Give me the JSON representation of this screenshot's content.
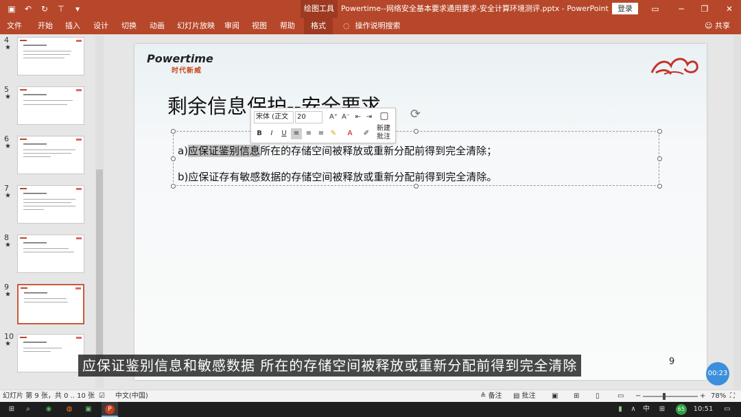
{
  "titlebar": {
    "context_tools": "绘图工具",
    "document_title": "Powertime--网络安全基本要求通用要求-安全计算环境测评.pptx - PowerPoint",
    "login": "登录",
    "restore_ribbon_icon": "ribbon-display-icon",
    "minimize": "─",
    "maximize": "❐",
    "close": "✕"
  },
  "ribbon": {
    "tabs": [
      "文件",
      "开始",
      "插入",
      "设计",
      "切换",
      "动画",
      "幻灯片放映",
      "审阅",
      "视图",
      "帮助",
      "格式"
    ],
    "active_tab": "格式",
    "tell_me": "操作说明搜索",
    "share": "共享"
  },
  "thumbnails": [
    {
      "num": "4",
      "star": "★"
    },
    {
      "num": "5",
      "star": "★"
    },
    {
      "num": "6",
      "star": "★"
    },
    {
      "num": "7",
      "star": "★"
    },
    {
      "num": "8",
      "star": "★"
    },
    {
      "num": "9",
      "star": "★"
    },
    {
      "num": "10",
      "star": "★"
    }
  ],
  "slide": {
    "logo_text": "Powertime",
    "logo_sub": "时代新威",
    "title": "剩余信息保护--安全要求",
    "bullet_a_prefix": "a)",
    "bullet_a_highlight": "应保证鉴别信息",
    "bullet_a_rest": "所在的存储空间被释放或重新分配前得到完全清除；",
    "bullet_b": "b)应保证存有敏感数据的存储空间被释放或重新分配前得到完全清除。",
    "number": "9"
  },
  "minibar": {
    "font": "宋体 (正文",
    "size": "20",
    "bold": "B",
    "italic": "I",
    "underline": "U",
    "new_comment": "新建批注"
  },
  "subtitle": "应保证鉴别信息和敏感数据  所在的存储空间被释放或重新分配前得到完全清除",
  "timer": "00:23",
  "statusbar": {
    "slide_info": "幻灯片 第 9 张，共 0 .. 10 张",
    "language": "中文(中国)",
    "notes": "备注",
    "comments": "批注",
    "zoom": "78%"
  },
  "taskbar": {
    "badge": "65",
    "ime": "中",
    "time": "10:51"
  }
}
